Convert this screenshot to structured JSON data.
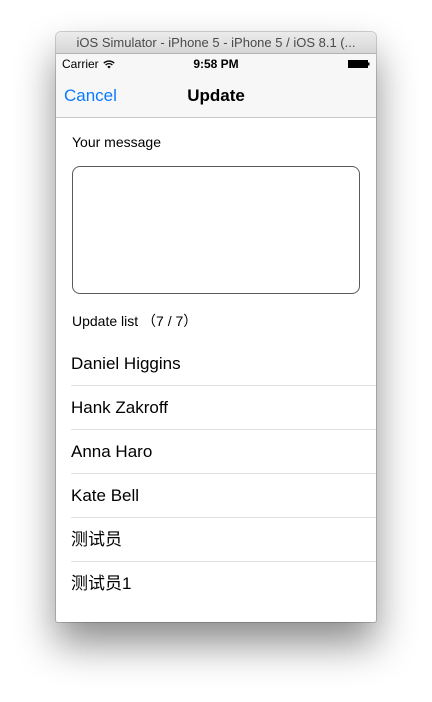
{
  "window": {
    "title": "iOS Simulator - iPhone 5 - iPhone 5 / iOS 8.1 (..."
  },
  "status_bar": {
    "carrier": "Carrier",
    "time": "9:58 PM",
    "wifi_icon": "wifi-icon",
    "battery_icon": "battery-icon"
  },
  "nav_bar": {
    "cancel_label": "Cancel",
    "title": "Update",
    "accent_color": "#0a7aff"
  },
  "message": {
    "label": "Your message",
    "value": ""
  },
  "update_list": {
    "label": "Update list （7 / 7）",
    "items": [
      "Daniel Higgins",
      "Hank Zakroff",
      "Anna Haro",
      "Kate Bell",
      "测试员",
      "测试员1"
    ]
  }
}
